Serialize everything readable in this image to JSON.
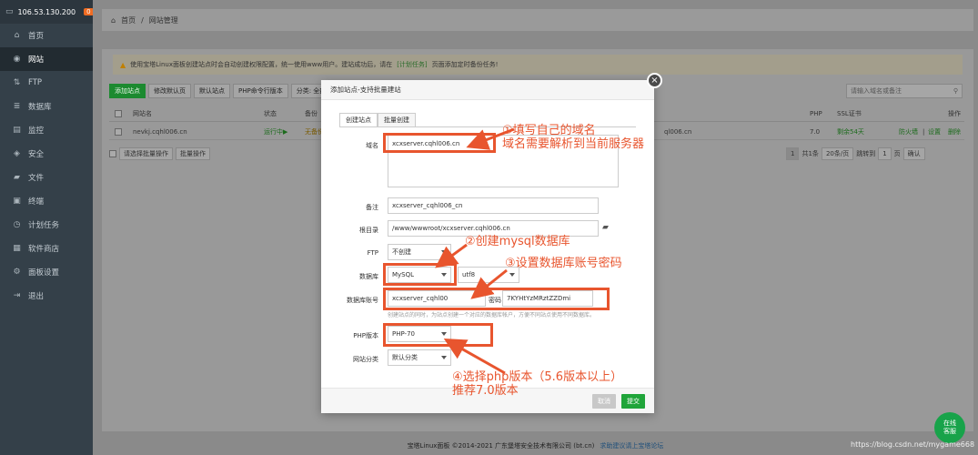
{
  "sidebar": {
    "ip": "106.53.130.200",
    "badge": "0",
    "items": [
      {
        "label": "首页",
        "icon": "home-icon"
      },
      {
        "label": "网站",
        "icon": "globe-icon"
      },
      {
        "label": "FTP",
        "icon": "ftp-icon"
      },
      {
        "label": "数据库",
        "icon": "database-icon"
      },
      {
        "label": "监控",
        "icon": "monitor-icon"
      },
      {
        "label": "安全",
        "icon": "shield-icon"
      },
      {
        "label": "文件",
        "icon": "folder-icon"
      },
      {
        "label": "终端",
        "icon": "terminal-icon"
      },
      {
        "label": "计划任务",
        "icon": "clock-icon"
      },
      {
        "label": "软件商店",
        "icon": "store-icon"
      },
      {
        "label": "面板设置",
        "icon": "gear-icon"
      },
      {
        "label": "退出",
        "icon": "logout-icon"
      }
    ]
  },
  "breadcrumb": {
    "home": "首页",
    "sep": "/",
    "current": "网站管理"
  },
  "notice": {
    "text1": "使用宝塔Linux面板创建站点时会自动创建权限配置，统一使用www用户。建站成功后，请在",
    "link": "[计划任务]",
    "text2": "页面添加定时备份任务!"
  },
  "toolbar": {
    "add_site": "添加站点",
    "edit_default": "修改默认页",
    "default_site": "默认站点",
    "php_cli": "PHP命令行版本",
    "category": "分类: 全部"
  },
  "search": {
    "placeholder": "请输入域名或备注"
  },
  "table": {
    "headers": {
      "name": "网站名",
      "status": "状态",
      "backup": "备份",
      "php": "PHP",
      "ssl": "SSL证书",
      "ops": "操作"
    },
    "row": {
      "name": "nevkj.cqhl006.cn",
      "status": "运行中▶",
      "backup": "无备份",
      "path": "ql006.cn",
      "php": "7.0",
      "ssl": "剩余54天",
      "ops1": "防火墙",
      "sep": "|",
      "ops2": "设置",
      "ops3": "删除"
    }
  },
  "batch": {
    "select": "请选择批量操作",
    "btn": "批量操作"
  },
  "pager": {
    "page": "1",
    "total": "共1条",
    "per_page": "20条/页",
    "jump": "跳转到",
    "page_input": "1",
    "page_unit": "页",
    "confirm": "确认"
  },
  "footer": {
    "copyright": "宝塔Linux面板 ©2014-2021 广东堡塔安全技术有限公司 (bt.cn)",
    "link": "求助建议请上宝塔论坛"
  },
  "modal": {
    "title": "添加站点-支持批量建站",
    "tab_create": "创建站点",
    "tab_batch": "批量创建",
    "domain_label": "域名",
    "domain_value": "xcxserver.cqhl006.cn",
    "remark_label": "备注",
    "remark_value": "xcxserver_cqhl006_cn",
    "root_label": "根目录",
    "root_value": "/www/wwwroot/xcxserver.cqhl006.cn",
    "ftp_label": "FTP",
    "ftp_value": "不创建",
    "db_label": "数据库",
    "db_value": "MySQL",
    "charset_value": "utf8",
    "dbacc_label": "数据库账号",
    "dbacc_value": "xcxserver_cqhl00",
    "pwd_label": "密码",
    "pwd_value": "7KYHtYzMRztZZDmi",
    "db_hint": "创建站点的同时，为站点创建一个对应的数据库帐户，方便不同站点使用不同数据库。",
    "php_label": "PHP版本",
    "php_value": "PHP-70",
    "cat_label": "网站分类",
    "cat_value": "默认分类",
    "cancel": "取消",
    "submit": "提交"
  },
  "annotations": {
    "a1_line1": "①填写自己的域名",
    "a1_line2": "域名需要解析到当前服务器",
    "a2": "②创建mysql数据库",
    "a3": "③设置数据库账号密码",
    "a4_line1": "④选择php版本（5.6版本以上）",
    "a4_line2": "推荐7.0版本"
  },
  "chat": {
    "line1": "在线",
    "line2": "客服"
  },
  "watermark": "https://blog.csdn.net/mygame668",
  "colors": {
    "accent": "#e8552e",
    "green": "#1c8a30",
    "sidebar": "#344049"
  }
}
